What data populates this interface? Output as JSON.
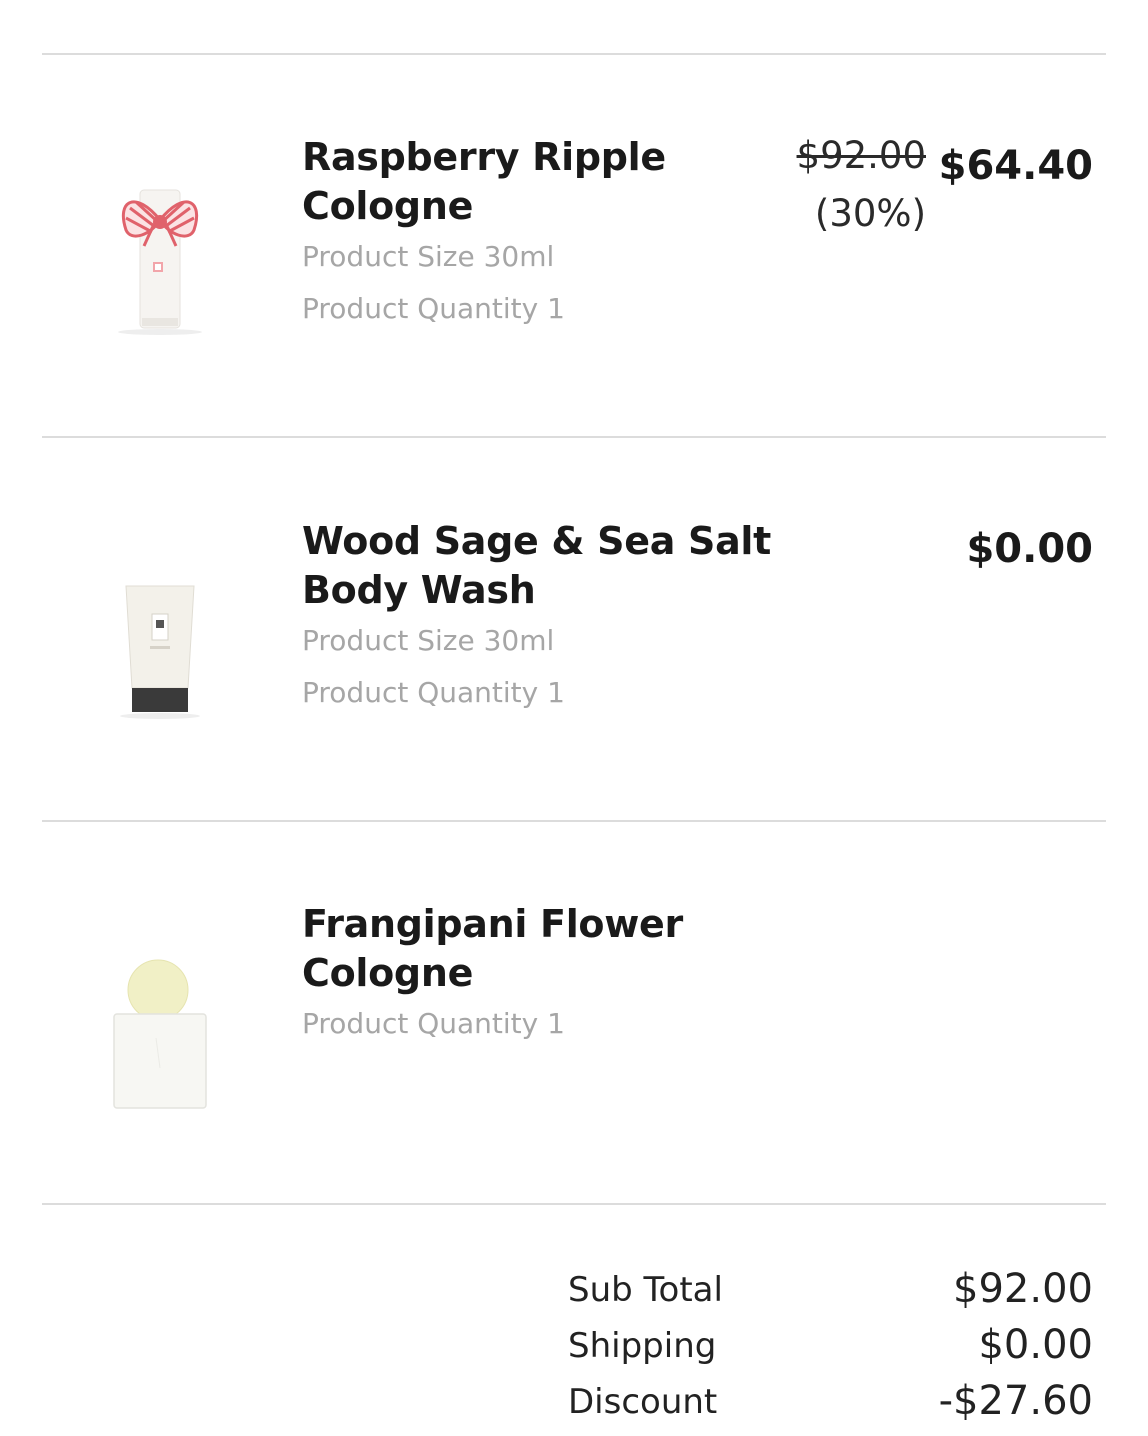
{
  "header": {
    "fragment": "..."
  },
  "items": [
    {
      "name": "Raspberry Ripple Cologne",
      "size": "Product Size 30ml",
      "quantity": "Product Quantity 1",
      "original_price": "$92.00",
      "discount_pct": "(30%)",
      "final_price": "$64.40",
      "image": "cologne-bottle-with-striped-bow"
    },
    {
      "name": "Wood Sage & Sea Salt Body Wash",
      "size": "Product Size 30ml",
      "quantity": "Product Quantity 1",
      "final_price": "$0.00",
      "image": "body-wash-tube"
    },
    {
      "name": "Frangipani Flower Cologne",
      "quantity": "Product Quantity 1",
      "image": "cologne-bottle-round-cap"
    }
  ],
  "summary": {
    "subtotal_label": "Sub Total",
    "subtotal_value": "$92.00",
    "shipping_label": "Shipping",
    "shipping_value": "$0.00",
    "discount_label": "Discount",
    "discount_value": "-$27.60"
  },
  "colors": {
    "divider": "#dcdcdc",
    "muted_text": "#a6a6a6",
    "primary_text": "#1a1a1a",
    "bow_red": "#e0626b"
  }
}
